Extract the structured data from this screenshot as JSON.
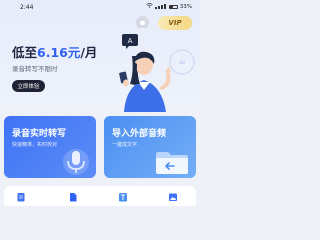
{
  "status_bar": {
    "time": "2:44",
    "battery": "33%"
  },
  "header": {
    "vip_label": "VIP"
  },
  "promo": {
    "price_prefix": "低至",
    "price": "6.16元",
    "price_suffix": "/月",
    "subtitle": "录音转写不限时",
    "cta_label": "立即体验",
    "bubble_letter": "A"
  },
  "features": [
    {
      "title": "录音实时转写",
      "desc": "快速精准，实时校对",
      "icon": "microphone-icon"
    },
    {
      "title": "导入外部音频",
      "desc": "一键成文字",
      "icon": "folder-import-icon"
    }
  ],
  "tools": [
    {
      "icon": "document-icon"
    },
    {
      "icon": "file-icon"
    },
    {
      "icon": "text-icon"
    },
    {
      "icon": "photo-icon"
    }
  ],
  "colors": {
    "accent": "#2f62f0",
    "card_record": "#3f73f5",
    "card_import": "#4b8ff2",
    "cta_bg": "#1e2233",
    "vip_gold": "#f3d783"
  }
}
